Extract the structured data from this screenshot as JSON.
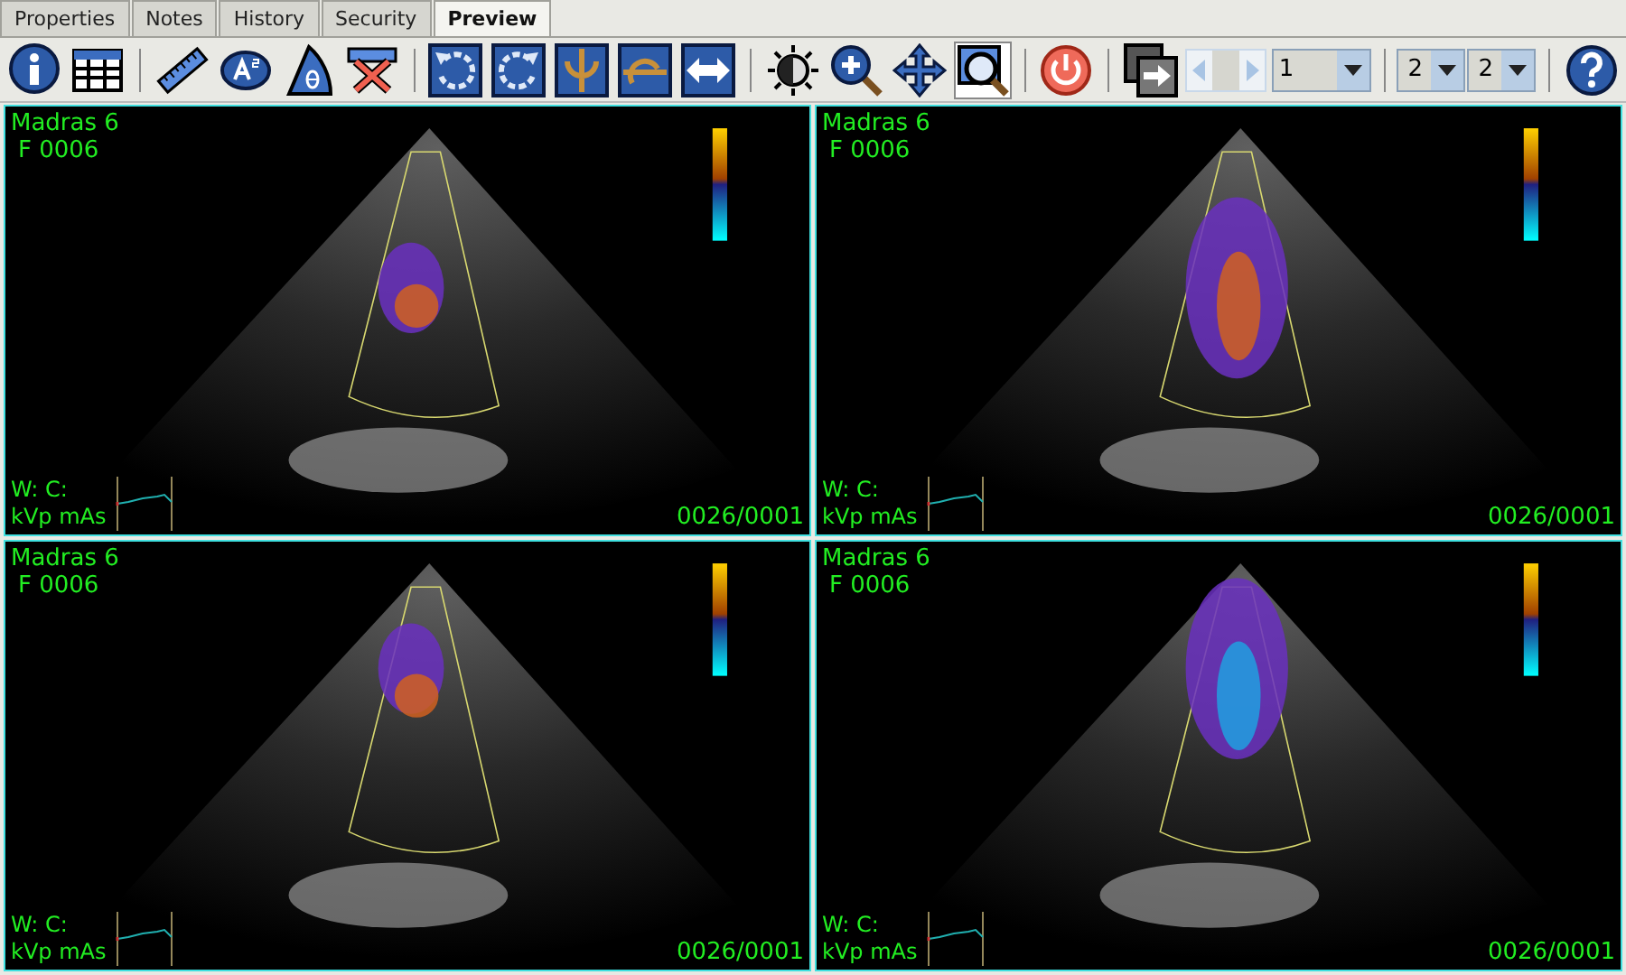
{
  "tabs": [
    {
      "label": "Properties",
      "selected": false
    },
    {
      "label": "Notes",
      "selected": false
    },
    {
      "label": "History",
      "selected": false
    },
    {
      "label": "Security",
      "selected": false
    },
    {
      "label": "Preview",
      "selected": true
    }
  ],
  "toolbar": [
    {
      "kind": "info",
      "selected": false
    },
    {
      "kind": "table",
      "selected": false
    },
    {
      "kind": "separator"
    },
    {
      "kind": "ruler",
      "selected": false
    },
    {
      "kind": "area",
      "selected": false
    },
    {
      "kind": "angle",
      "selected": false
    },
    {
      "kind": "clear",
      "selected": false
    },
    {
      "kind": "separator"
    },
    {
      "kind": "rotate-left",
      "selected": false
    },
    {
      "kind": "rotate-right",
      "selected": false
    },
    {
      "kind": "flip-vertical",
      "selected": false
    },
    {
      "kind": "flip-horizontal",
      "selected": false
    },
    {
      "kind": "swap",
      "selected": false
    },
    {
      "kind": "separator"
    },
    {
      "kind": "brightness",
      "selected": false
    },
    {
      "kind": "zoom-in",
      "selected": false
    },
    {
      "kind": "pan",
      "selected": false
    },
    {
      "kind": "zoom-box",
      "selected": true
    },
    {
      "kind": "separator"
    },
    {
      "kind": "power",
      "selected": false
    },
    {
      "kind": "separator"
    },
    {
      "kind": "next-window",
      "selected": false
    },
    {
      "kind": "scrollbar"
    },
    {
      "kind": "spinner",
      "value": "1"
    },
    {
      "kind": "separator"
    },
    {
      "kind": "dropdown",
      "value": "2"
    },
    {
      "kind": "dropdown",
      "value": "2"
    },
    {
      "kind": "separator"
    },
    {
      "kind": "help",
      "selected": false
    }
  ],
  "viewports": [
    {
      "patient": "Madras 6",
      "frame": "F 0006",
      "window": "W:  C:",
      "exposure": "kVp mAs",
      "counter": "0026/0001"
    },
    {
      "patient": "Madras 6",
      "frame": "F 0006",
      "window": "W:  C:",
      "exposure": "kVp mAs",
      "counter": "0026/0001"
    },
    {
      "patient": "Madras 6",
      "frame": "F 0006",
      "window": "W:  C:",
      "exposure": "kVp mAs",
      "counter": "0026/0001"
    },
    {
      "patient": "Madras 6",
      "frame": "F 0006",
      "window": "W:  C:",
      "exposure": "kVp mAs",
      "counter": "0026/0001"
    }
  ]
}
